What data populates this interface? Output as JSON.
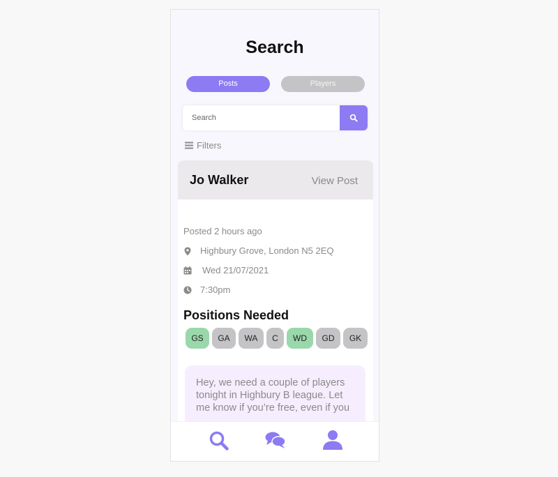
{
  "page": {
    "title": "Search"
  },
  "tabs": [
    {
      "label": "Posts",
      "active": true
    },
    {
      "label": "Players",
      "active": false
    }
  ],
  "search": {
    "placeholder": "Search",
    "value": "",
    "button_icon": "search-icon"
  },
  "filters": {
    "label": "Filters",
    "icon": "menu-icon"
  },
  "post": {
    "author": "Jo Walker",
    "view_label": "View Post",
    "posted": "Posted 2 hours ago",
    "location": "Highbury Grove, London N5 2EQ",
    "date": "Wed 21/07/2021",
    "time": "7:30pm",
    "positions_title": "Positions Needed",
    "positions": [
      {
        "code": "GS",
        "needed": true
      },
      {
        "code": "GA",
        "needed": false
      },
      {
        "code": "WA",
        "needed": false
      },
      {
        "code": "C",
        "needed": false
      },
      {
        "code": "WD",
        "needed": true
      },
      {
        "code": "GD",
        "needed": false
      },
      {
        "code": "GK",
        "needed": false
      }
    ],
    "message": "Hey, we need a couple of players tonight in Highbury B league. Let me know if you’re free, even if you"
  },
  "nav": {
    "items": [
      {
        "icon": "search-icon"
      },
      {
        "icon": "chat-icon"
      },
      {
        "icon": "user-icon"
      }
    ]
  },
  "colors": {
    "accent": "#8c7bf2",
    "chip_needed": "#9ad8ab",
    "chip_filled": "#c4c4c6",
    "message_bg": "#f6eefe"
  }
}
